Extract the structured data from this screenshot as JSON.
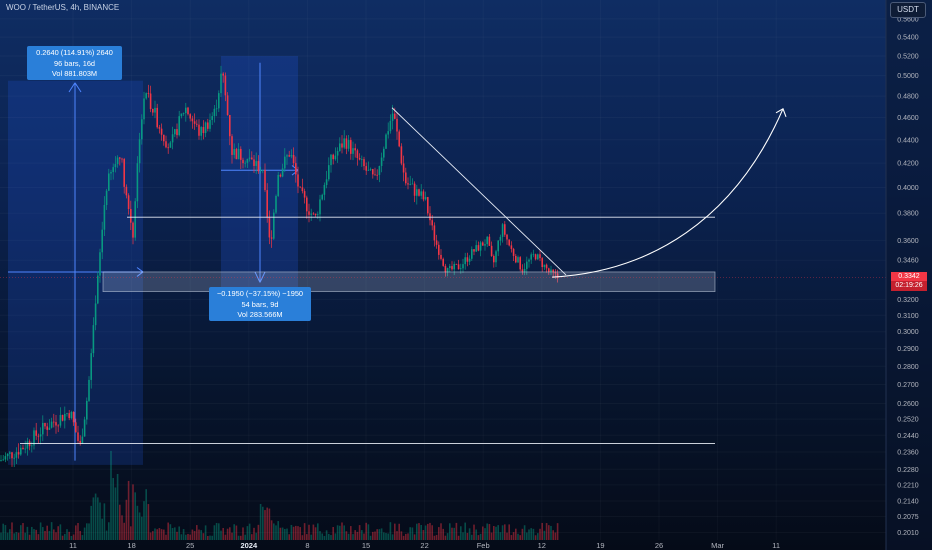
{
  "legend": "WOO / TetherUS, 4h, BINANCE",
  "currency_button": "USDT",
  "measure_up": {
    "line1": "0.2640 (114.91%) 2640",
    "line2": "96 bars, 16d",
    "line3": "Vol 881.803M"
  },
  "measure_down": {
    "line1": "−0.1950 (−37.15%) −1950",
    "line2": "54 bars, 9d",
    "line3": "Vol 283.566M"
  },
  "last_price": "0.3342",
  "countdown": "02:19:26",
  "colors": {
    "bull": "#089981",
    "bear": "#f23645",
    "measure": "#2962ff",
    "label": "#2a7fd9",
    "text": "#b2b5be"
  },
  "price_axis": [
    {
      "label": "0.5600",
      "v": 0.56
    },
    {
      "label": "0.5400",
      "v": 0.54
    },
    {
      "label": "0.5200",
      "v": 0.52
    },
    {
      "label": "0.5000",
      "v": 0.5
    },
    {
      "label": "0.4800",
      "v": 0.48
    },
    {
      "label": "0.4600",
      "v": 0.46
    },
    {
      "label": "0.4400",
      "v": 0.44
    },
    {
      "label": "0.4200",
      "v": 0.42
    },
    {
      "label": "0.4000",
      "v": 0.4
    },
    {
      "label": "0.3800",
      "v": 0.38
    },
    {
      "label": "0.3600",
      "v": 0.36
    },
    {
      "label": "0.3460",
      "v": 0.346
    },
    {
      "label": "0.3200",
      "v": 0.32
    },
    {
      "label": "0.3100",
      "v": 0.31
    },
    {
      "label": "0.3000",
      "v": 0.3
    },
    {
      "label": "0.2900",
      "v": 0.29
    },
    {
      "label": "0.2800",
      "v": 0.28
    },
    {
      "label": "0.2700",
      "v": 0.27
    },
    {
      "label": "0.2600",
      "v": 0.26
    },
    {
      "label": "0.2520",
      "v": 0.252
    },
    {
      "label": "0.2440",
      "v": 0.244
    },
    {
      "label": "0.2360",
      "v": 0.236
    },
    {
      "label": "0.2280",
      "v": 0.228
    },
    {
      "label": "0.2210",
      "v": 0.221
    },
    {
      "label": "0.2140",
      "v": 0.214
    },
    {
      "label": "0.2075",
      "v": 0.2075
    },
    {
      "label": "0.2010",
      "v": 0.201
    }
  ],
  "time_axis": [
    "11",
    "18",
    "25",
    "2024",
    "8",
    "15",
    "22",
    "Feb",
    "12",
    "19",
    "26",
    "Mar",
    "11"
  ],
  "chart_data": {
    "type": "candlestick",
    "symbol": "WOO / TetherUS",
    "timeframe": "4h",
    "exchange": "BINANCE",
    "y_scale": "log",
    "ylim": [
      0.198,
      0.57
    ],
    "anchors": [
      {
        "x": 0,
        "close": 0.232
      },
      {
        "x": 22,
        "close": 0.238
      },
      {
        "x": 45,
        "close": 0.248
      },
      {
        "x": 70,
        "close": 0.256
      },
      {
        "x": 80,
        "close": 0.238
      },
      {
        "x": 88,
        "close": 0.266
      },
      {
        "x": 95,
        "close": 0.31
      },
      {
        "x": 100,
        "close": 0.35
      },
      {
        "x": 106,
        "close": 0.4
      },
      {
        "x": 120,
        "close": 0.43
      },
      {
        "x": 127,
        "close": 0.39
      },
      {
        "x": 133,
        "close": 0.365
      },
      {
        "x": 140,
        "close": 0.45
      },
      {
        "x": 146,
        "close": 0.485
      },
      {
        "x": 158,
        "close": 0.455
      },
      {
        "x": 170,
        "close": 0.432
      },
      {
        "x": 185,
        "close": 0.47
      },
      {
        "x": 200,
        "close": 0.445
      },
      {
        "x": 215,
        "close": 0.465
      },
      {
        "x": 222,
        "close": 0.505
      },
      {
        "x": 232,
        "close": 0.43
      },
      {
        "x": 245,
        "close": 0.425
      },
      {
        "x": 262,
        "close": 0.415
      },
      {
        "x": 270,
        "close": 0.355
      },
      {
        "x": 278,
        "close": 0.41
      },
      {
        "x": 290,
        "close": 0.43
      },
      {
        "x": 300,
        "close": 0.395
      },
      {
        "x": 315,
        "close": 0.375
      },
      {
        "x": 330,
        "close": 0.42
      },
      {
        "x": 345,
        "close": 0.44
      },
      {
        "x": 360,
        "close": 0.42
      },
      {
        "x": 375,
        "close": 0.405
      },
      {
        "x": 388,
        "close": 0.45
      },
      {
        "x": 393,
        "close": 0.465
      },
      {
        "x": 405,
        "close": 0.405
      },
      {
        "x": 418,
        "close": 0.395
      },
      {
        "x": 425,
        "close": 0.39
      },
      {
        "x": 435,
        "close": 0.36
      },
      {
        "x": 447,
        "close": 0.338
      },
      {
        "x": 460,
        "close": 0.342
      },
      {
        "x": 473,
        "close": 0.352
      },
      {
        "x": 487,
        "close": 0.36
      },
      {
        "x": 493,
        "close": 0.342
      },
      {
        "x": 502,
        "close": 0.37
      },
      {
        "x": 510,
        "close": 0.355
      },
      {
        "x": 522,
        "close": 0.34
      },
      {
        "x": 535,
        "close": 0.35
      },
      {
        "x": 550,
        "close": 0.337
      },
      {
        "x": 558,
        "close": 0.3342
      }
    ]
  }
}
